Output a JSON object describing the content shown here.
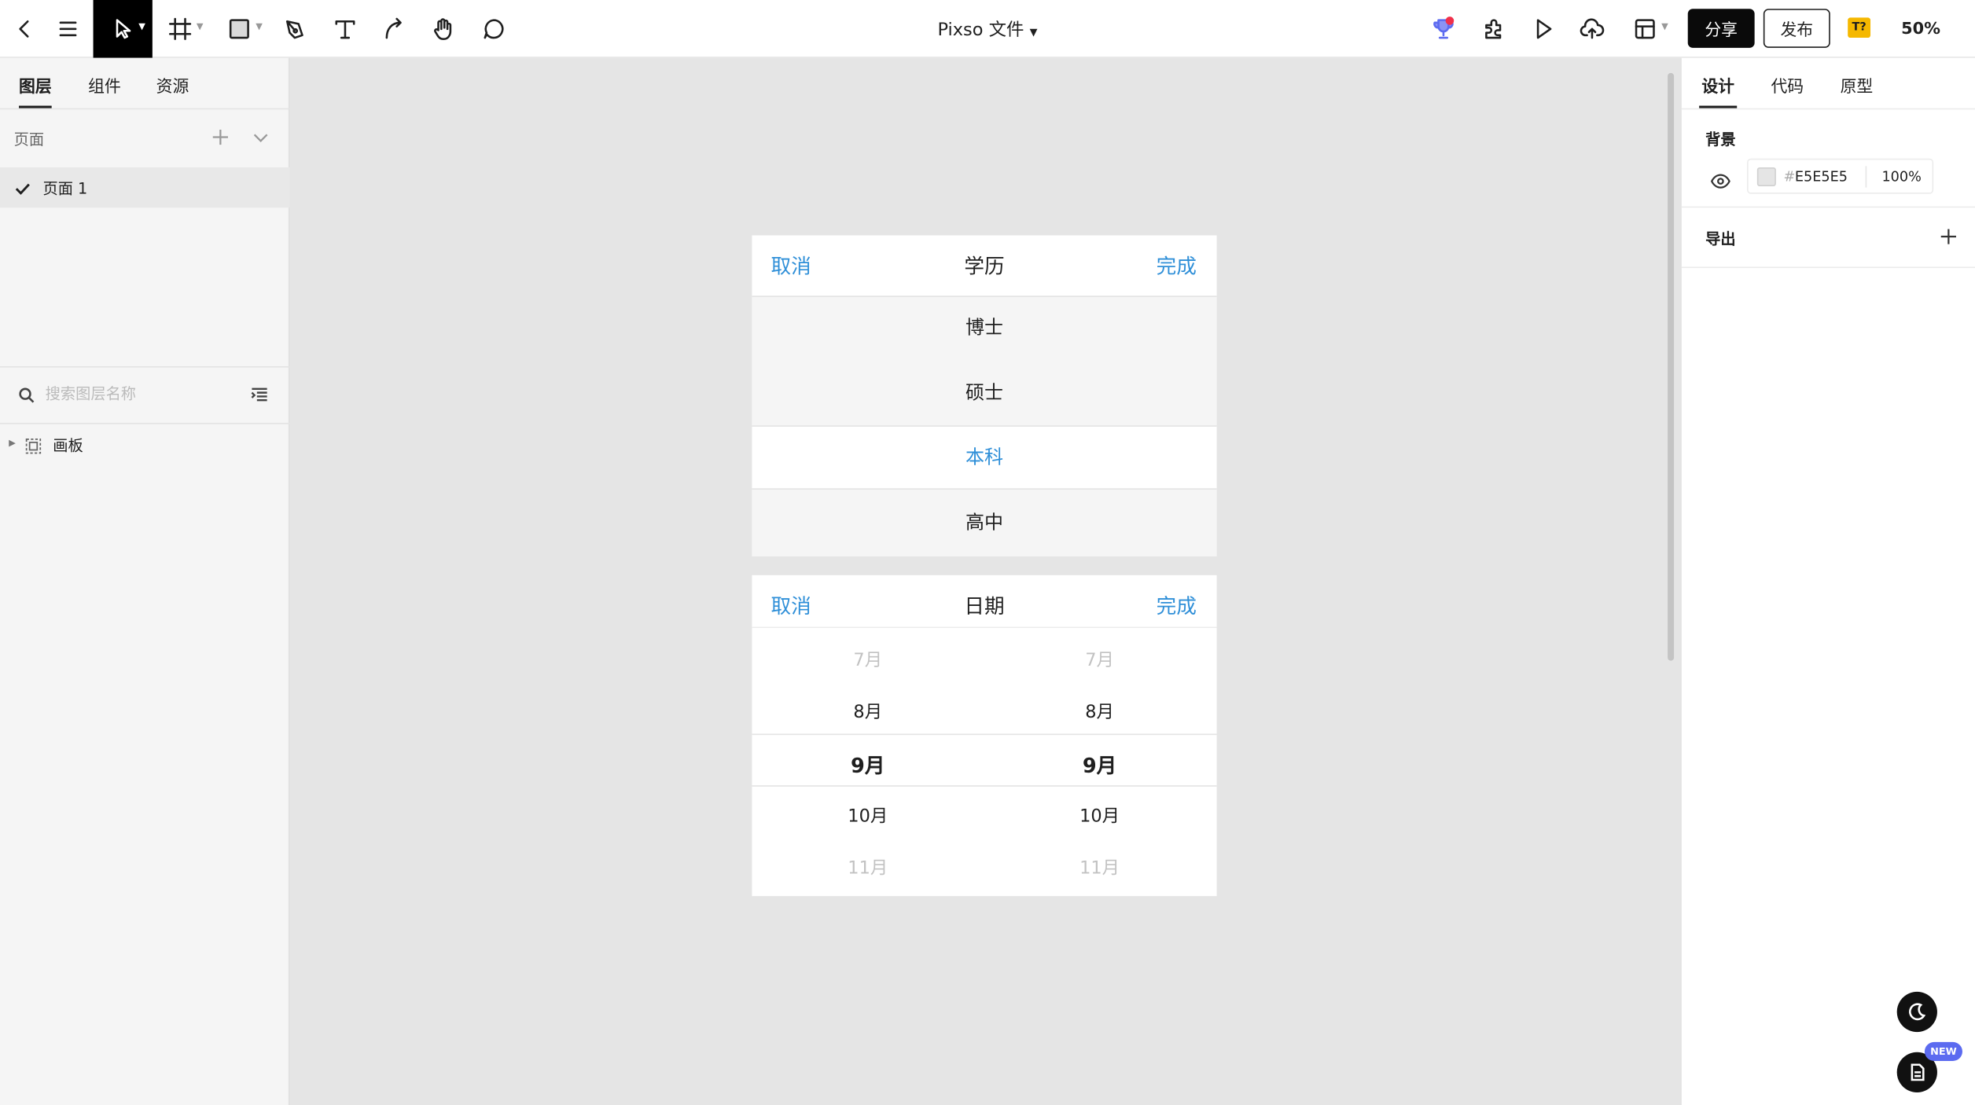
{
  "toolbar": {
    "file_title": "Pixso 文件",
    "share_label": "分享",
    "publish_label": "发布",
    "font_badge": "T?",
    "zoom": "50%"
  },
  "left_panel": {
    "tabs": [
      {
        "label": "图层"
      },
      {
        "label": "组件"
      },
      {
        "label": "资源"
      }
    ],
    "pages_title": "页面",
    "pages": [
      {
        "label": "页面 1"
      }
    ],
    "search": {
      "placeholder": "搜索图层名称"
    },
    "layers": [
      {
        "label": "画板"
      }
    ]
  },
  "right_panel": {
    "tabs": [
      {
        "label": "设计"
      },
      {
        "label": "代码"
      },
      {
        "label": "原型"
      }
    ],
    "background": {
      "title": "背景",
      "hash": "#",
      "hex": "E5E5E5",
      "opacity": "100%"
    },
    "export": {
      "title": "导出"
    }
  },
  "canvas": {
    "background_color": "#E5E5E5",
    "education_picker": {
      "cancel": "取消",
      "title": "学历",
      "done": "完成",
      "options": [
        {
          "label": "博士"
        },
        {
          "label": "硕士"
        },
        {
          "label": "本科"
        },
        {
          "label": "高中"
        }
      ],
      "selected": "本科"
    },
    "date_picker": {
      "cancel": "取消",
      "title": "日期",
      "done": "完成",
      "left_column": [
        "7月",
        "8月",
        "9月",
        "10月",
        "11月"
      ],
      "right_column": [
        "7月",
        "8月",
        "9月",
        "10月",
        "11月"
      ],
      "selected": "9月"
    }
  },
  "floating": {
    "new_badge": "NEW"
  },
  "colors": {
    "accent_blue": "#2F8FD8",
    "toolbar_active": "#000000",
    "new_badge": "#5C6BF0",
    "font_badge": "#F5B800"
  }
}
